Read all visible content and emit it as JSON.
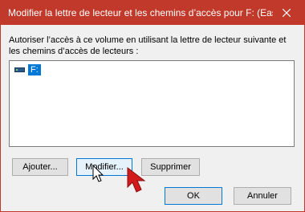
{
  "window": {
    "title": "Modifier la lettre de lecteur et les chemins d’accès pour F: (Eas",
    "accent_color": "#c0392b"
  },
  "dialog": {
    "instruction": "Autoriser l’accès à ce volume en utilisant la lettre de lecteur suivante et les chemins d’accès de lecteurs :",
    "list_items": [
      {
        "label": "F:",
        "icon": "drive-icon",
        "selected": true
      }
    ],
    "buttons": {
      "add": "Ajouter...",
      "modify": "Modifier...",
      "remove": "Supprimer",
      "ok": "OK",
      "cancel": "Annuler"
    }
  },
  "icons": {
    "close": "close-icon",
    "cursor": "mouse-cursor-icon",
    "pointer": "red-arrow-pointer-icon"
  }
}
